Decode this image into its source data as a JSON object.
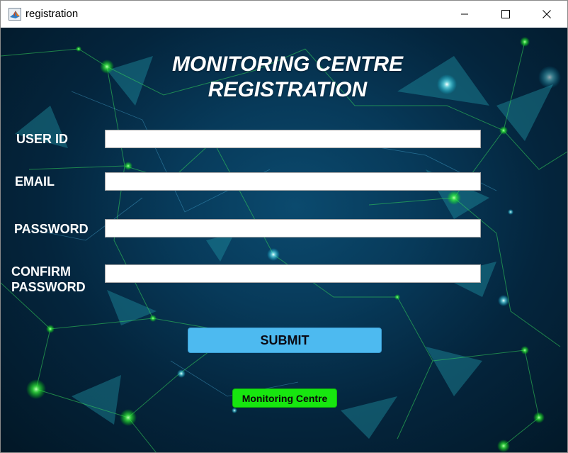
{
  "window": {
    "title": "registration",
    "app_icon": "matlab-icon",
    "controls": [
      "minimize-icon",
      "maximize-icon",
      "close-icon"
    ]
  },
  "heading": {
    "line1": "MONITORING CENTRE",
    "line2": "REGISTRATION"
  },
  "form": {
    "user_id_label": "USER ID",
    "user_id_value": "",
    "email_label": "EMAIL",
    "email_value": "",
    "password_label": "PASSWORD",
    "password_value": "",
    "confirm_label_line1": "CONFIRM",
    "confirm_label_line2": "PASSWORD",
    "confirm_value": ""
  },
  "buttons": {
    "submit_label": "SUBMIT",
    "monitoring_label": "Monitoring Centre"
  },
  "colors": {
    "background": "#04253d",
    "submit": "#4dbaf0",
    "monitoring_badge": "#17e60f",
    "heading_text": "#ffffff"
  }
}
